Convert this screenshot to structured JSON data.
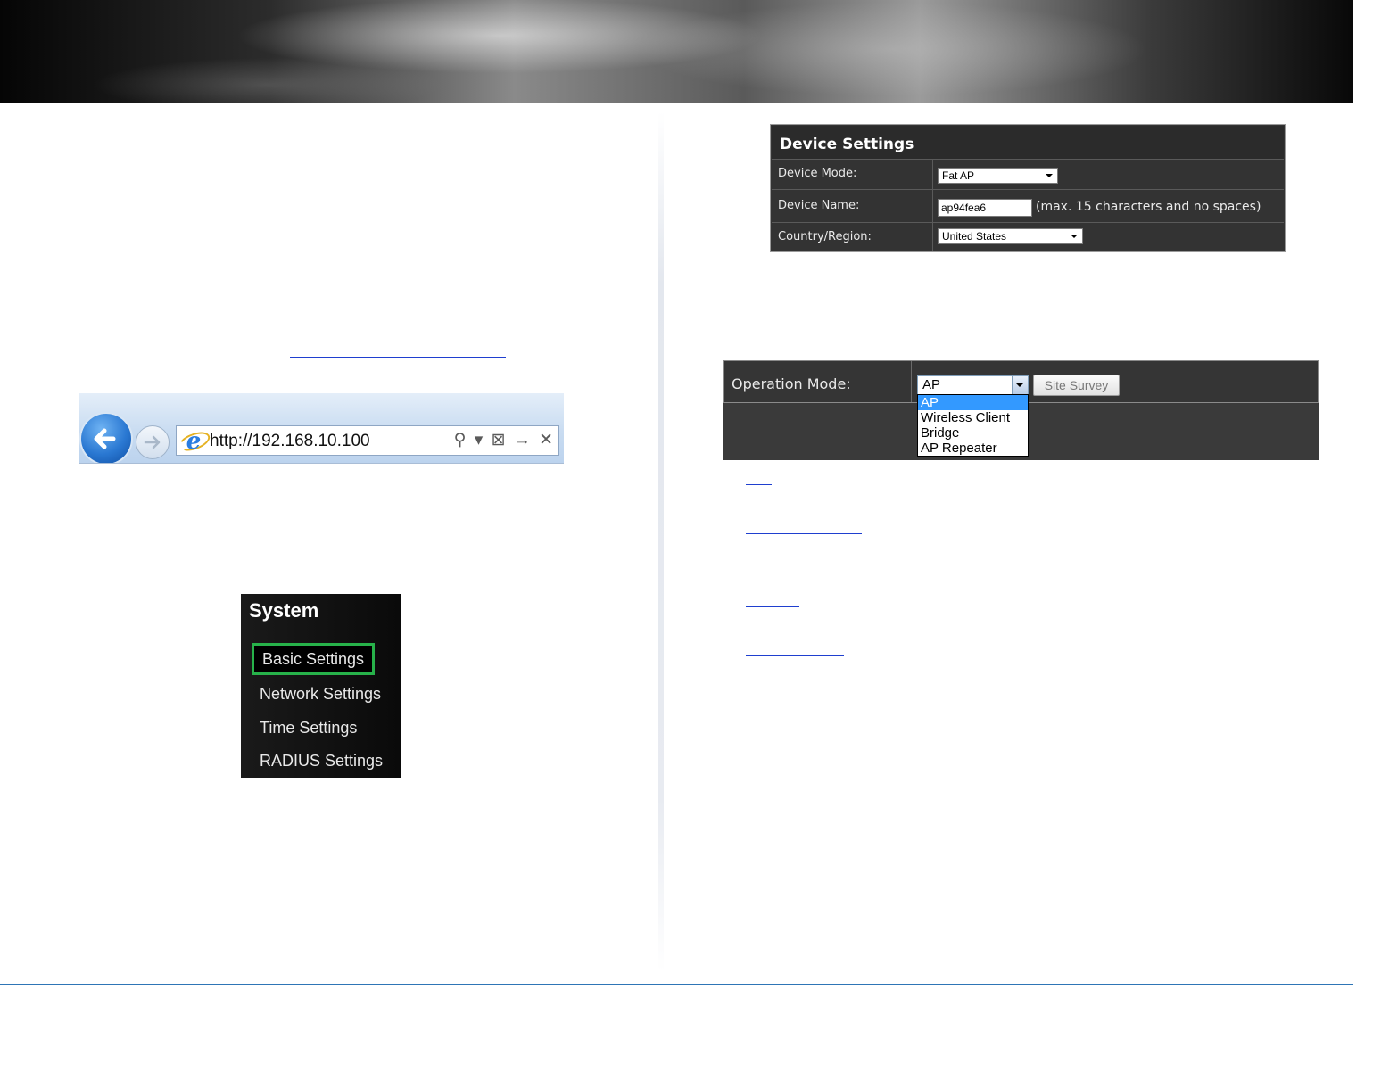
{
  "browser": {
    "url": "http://192.168.10.100",
    "tools": [
      "⚲",
      "▾",
      "⊠",
      "→",
      "✕"
    ]
  },
  "system_menu": {
    "title": "System",
    "items": [
      {
        "label": "Basic Settings",
        "active": true
      },
      {
        "label": "Network Settings",
        "active": false
      },
      {
        "label": "Time Settings",
        "active": false
      },
      {
        "label": "RADIUS Settings",
        "active": false
      }
    ],
    "highlight_color": "#27b24a"
  },
  "device_settings": {
    "title": "Device Settings",
    "device_mode_label": "Device Mode:",
    "device_mode_value": "Fat AP",
    "device_name_label": "Device Name:",
    "device_name_value": "ap94fea6",
    "device_name_hint": "(max. 15 characters and no spaces)",
    "country_label": "Country/Region:",
    "country_value": "United States"
  },
  "operation_mode": {
    "label": "Operation Mode:",
    "selected": "AP",
    "site_survey_label": "Site Survey",
    "options": [
      "AP",
      "Wireless Client",
      "Bridge",
      "AP Repeater"
    ]
  },
  "colors": {
    "link": "#1f3fcf",
    "footer_rule": "#2e75b6",
    "dropdown_highlight": "#3399ff"
  }
}
